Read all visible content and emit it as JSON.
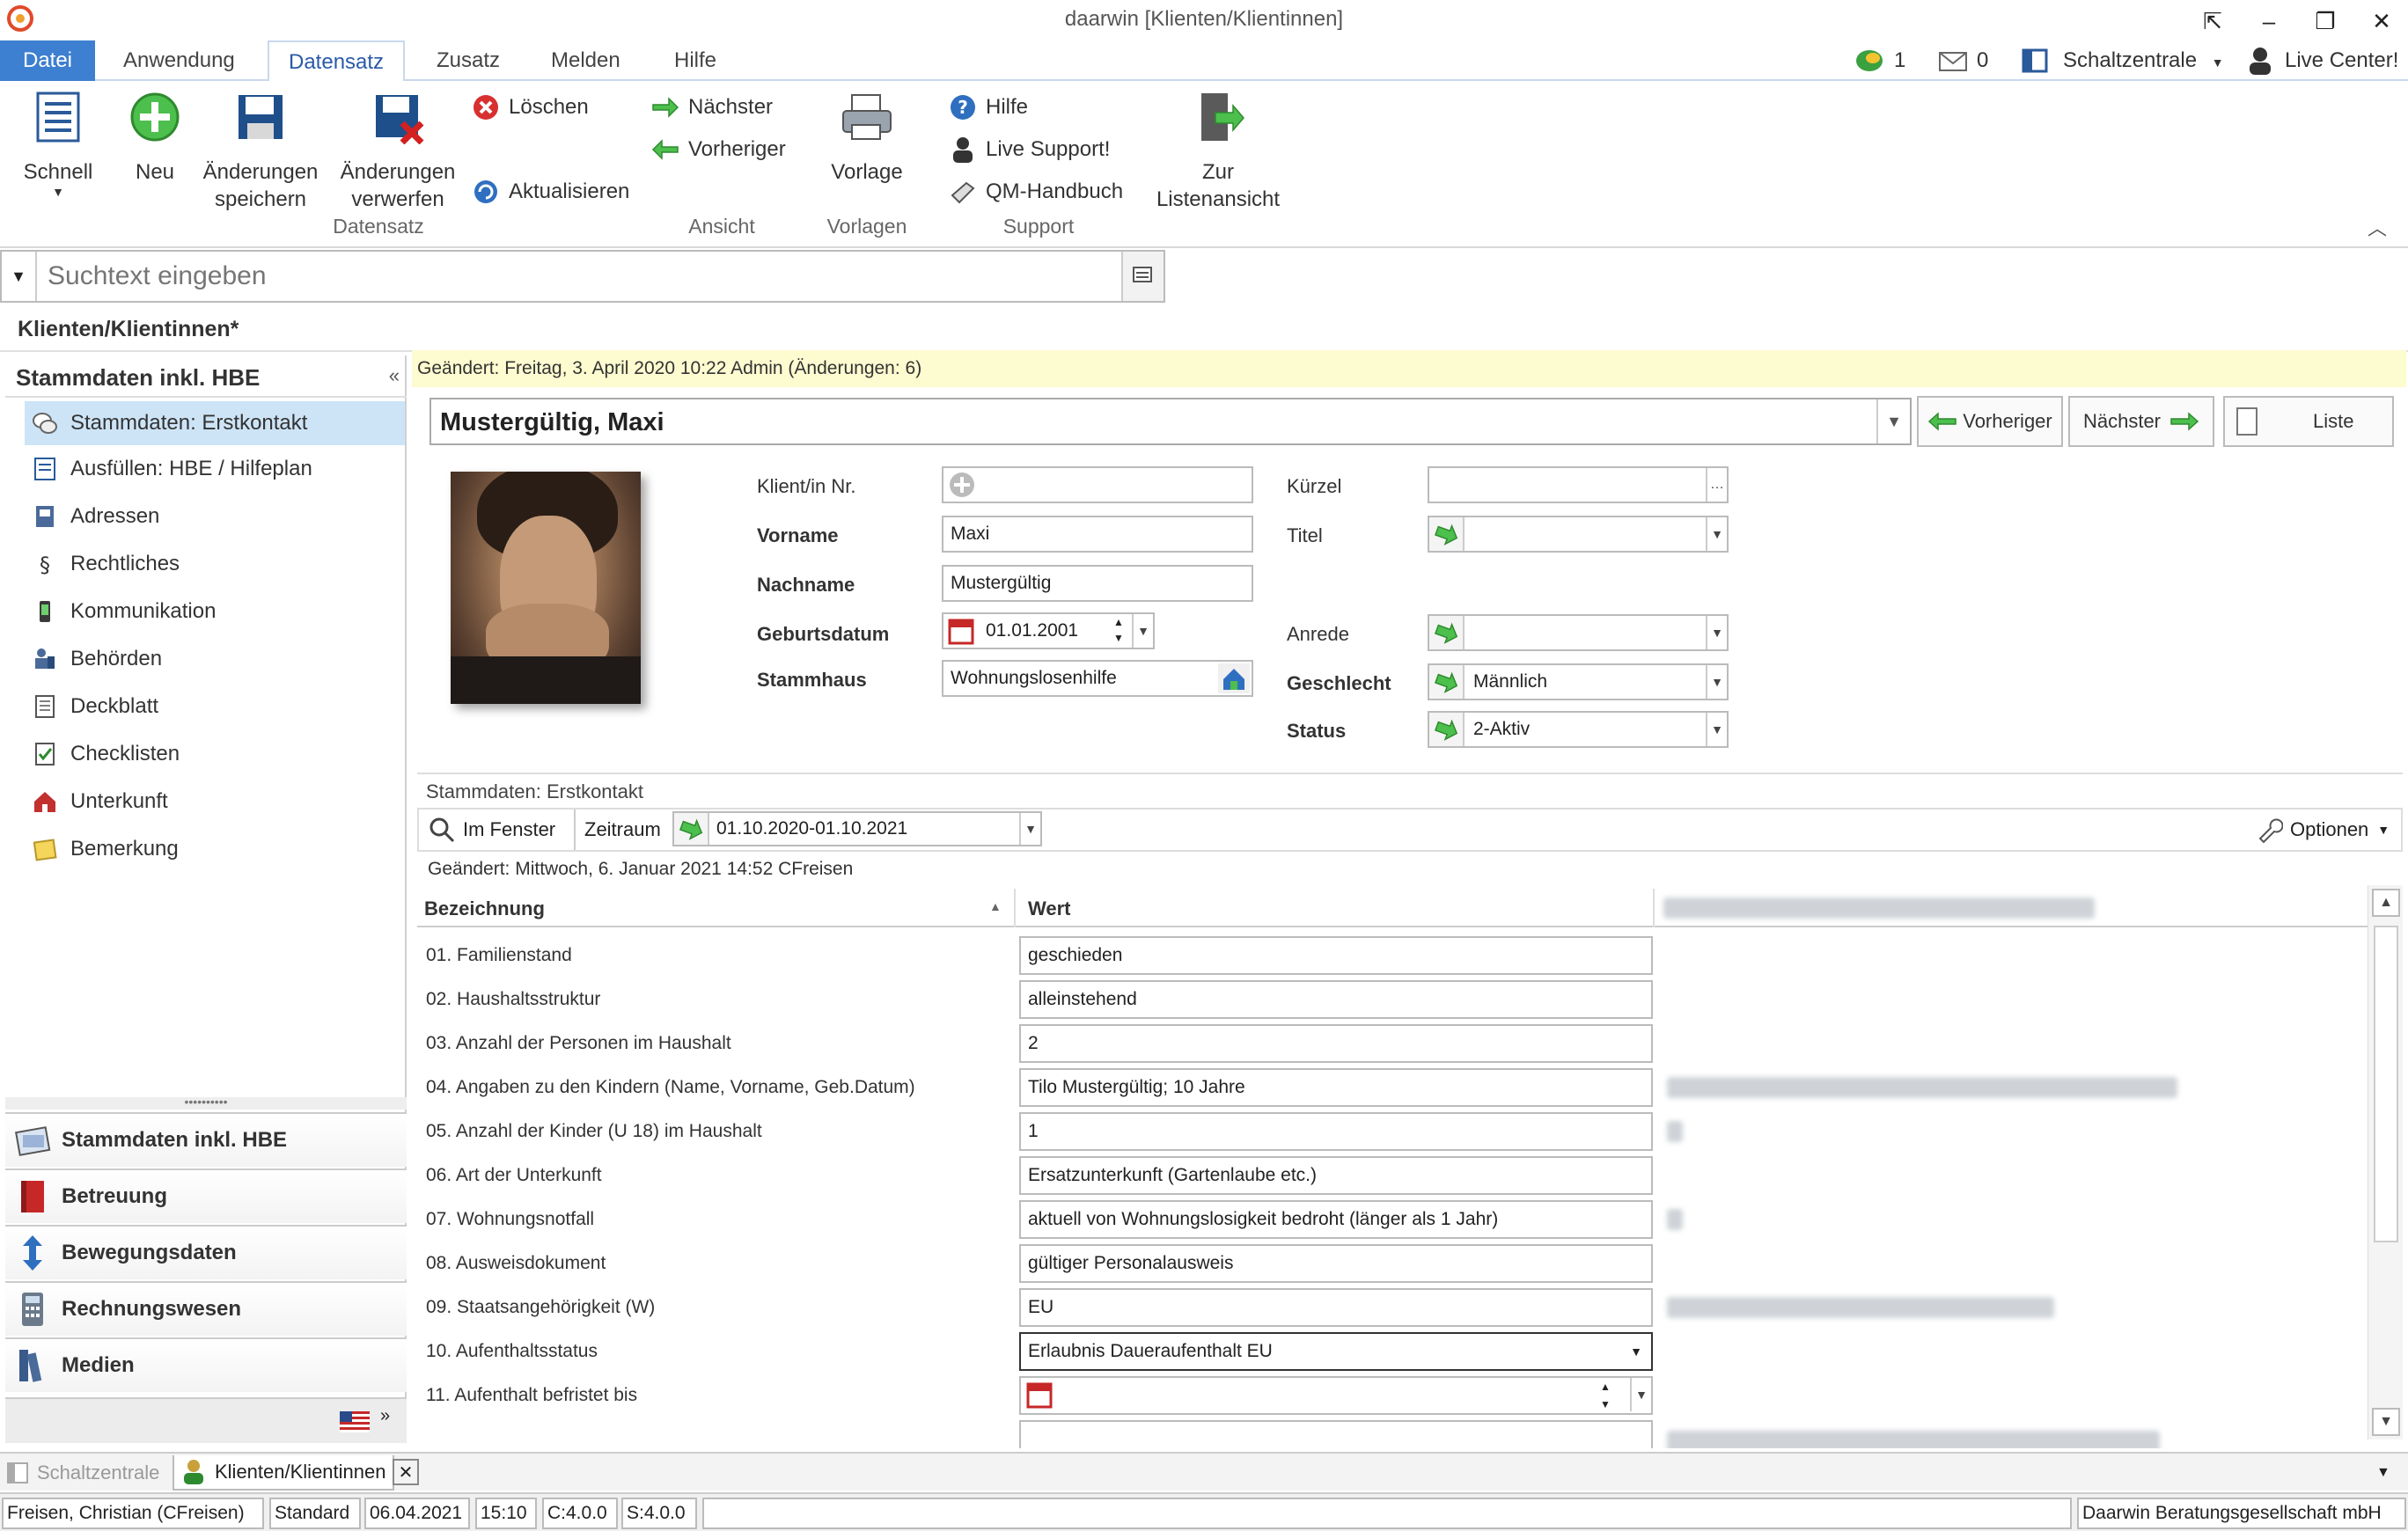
{
  "window": {
    "title": "daarwin [Klienten/Klientinnen]",
    "buttons": [
      "⇱",
      "–",
      "❐",
      "✕"
    ]
  },
  "ribbon_tabs": [
    "Datei",
    "Anwendung",
    "Datensatz",
    "Zusatz",
    "Melden",
    "Hilfe"
  ],
  "topright": {
    "count1": "1",
    "count2": "0",
    "schaltzentrale": "Schaltzentrale",
    "live_center": "Live Center!"
  },
  "ribbon": {
    "schnell": "Schnell",
    "neu": "Neu",
    "save_l1": "Änderungen",
    "save_l2": "speichern",
    "discard_l1": "Änderungen",
    "discard_l2": "verwerfen",
    "loeschen": "Löschen",
    "aktualisieren": "Aktualisieren",
    "group_datensatz": "Datensatz",
    "naechster": "Nächster",
    "vorheriger": "Vorheriger",
    "group_ansicht": "Ansicht",
    "vorlage": "Vorlage",
    "group_vorlagen": "Vorlagen",
    "hilfe": "Hilfe",
    "live_support": "Live Support!",
    "qm": "QM-Handbuch",
    "group_support": "Support",
    "list_l1": "Zur",
    "list_l2": "Listenansicht"
  },
  "search": {
    "placeholder": "Suchtext eingeben"
  },
  "document_caption": "Klienten/Klientinnen*",
  "left_panel": {
    "title": "Stammdaten inkl. HBE",
    "collapse": "«",
    "items": [
      "Stammdaten: Erstkontakt",
      "Ausfüllen: HBE / Hilfeplan",
      "Adressen",
      "Rechtliches",
      "Kommunikation",
      "Behörden",
      "Deckblatt",
      "Checklisten",
      "Unterkunft",
      "Bemerkung"
    ],
    "sections": [
      "Stammdaten inkl. HBE",
      "Betreuung",
      "Bewegungsdaten",
      "Rechnungswesen",
      "Medien"
    ],
    "splitter": "••••••••••"
  },
  "record": {
    "changed": "Geändert: Freitag, 3. April 2020 10:22   Admin  (Änderungen: 6)",
    "name": "Mustergültig, Maxi",
    "btn_prev": "Vorheriger",
    "btn_next": "Nächster",
    "btn_list": "Liste",
    "labels": {
      "klient_nr": "Klient/in Nr.",
      "vorname": "Vorname",
      "nachname": "Nachname",
      "geburtsdatum": "Geburtsdatum",
      "stammhaus": "Stammhaus",
      "kuerzel": "Kürzel",
      "titel": "Titel",
      "anrede": "Anrede",
      "geschlecht": "Geschlecht",
      "status": "Status"
    },
    "values": {
      "klient_nr": "",
      "vorname": "Maxi",
      "nachname": "Mustergültig",
      "geburtsdatum": "01.01.2001",
      "stammhaus": "Wohnungslosenhilfe",
      "kuerzel": "",
      "titel": "",
      "anrede": "",
      "geschlecht": "Männlich",
      "status": "2-Aktiv"
    }
  },
  "subpanel": {
    "title": "Stammdaten: Erstkontakt",
    "im_fenster": "Im Fenster",
    "zeitraum": "Zeitraum",
    "zeitraum_value": "01.10.2020-01.10.2021",
    "optionen": "Optionen",
    "changed": "Geändert: Mittwoch, 6. Januar 2021 14:52   CFreisen",
    "col_bezeichnung": "Bezeichnung",
    "col_wert": "Wert",
    "rows": [
      {
        "label": "01. Familienstand",
        "value": "geschieden"
      },
      {
        "label": "02. Haushaltsstruktur",
        "value": "alleinstehend"
      },
      {
        "label": "03. Anzahl der Personen im Haushalt",
        "value": "2"
      },
      {
        "label": "04. Angaben zu den Kindern (Name, Vorname, Geb.Datum)",
        "value": "Tilo Mustergültig; 10 Jahre"
      },
      {
        "label": "05. Anzahl der Kinder (U 18) im Haushalt",
        "value": "1"
      },
      {
        "label": "06. Art der Unterkunft",
        "value": "Ersatzunterkunft (Gartenlaube etc.)"
      },
      {
        "label": "07. Wohnungsnotfall",
        "value": "aktuell von Wohnungslosigkeit bedroht (länger als 1 Jahr)"
      },
      {
        "label": "08. Ausweisdokument",
        "value": "gültiger Personalausweis"
      },
      {
        "label": "09. Staatsangehörigkeit (W)",
        "value": "EU"
      },
      {
        "label": "10. Aufenthaltsstatus",
        "value": "Erlaubnis Daueraufenthalt EU"
      },
      {
        "label": "11. Aufenthalt befristet bis",
        "value": ""
      }
    ]
  },
  "doc_tabs": [
    "Schaltzentrale",
    "Klienten/Klientinnen"
  ],
  "status_bar": {
    "user": "Freisen, Christian  (CFreisen)",
    "profile": "Standard",
    "date": "06.04.2021",
    "time": "15:10",
    "c": "C:4.0.0",
    "s": "S:4.0.0",
    "company": "Daarwin Beratungsgesellschaft mbH"
  },
  "colors": {
    "accent": "#3d7fd0",
    "selected": "#cde4f7",
    "changed_bar": "#fdfbd0"
  }
}
